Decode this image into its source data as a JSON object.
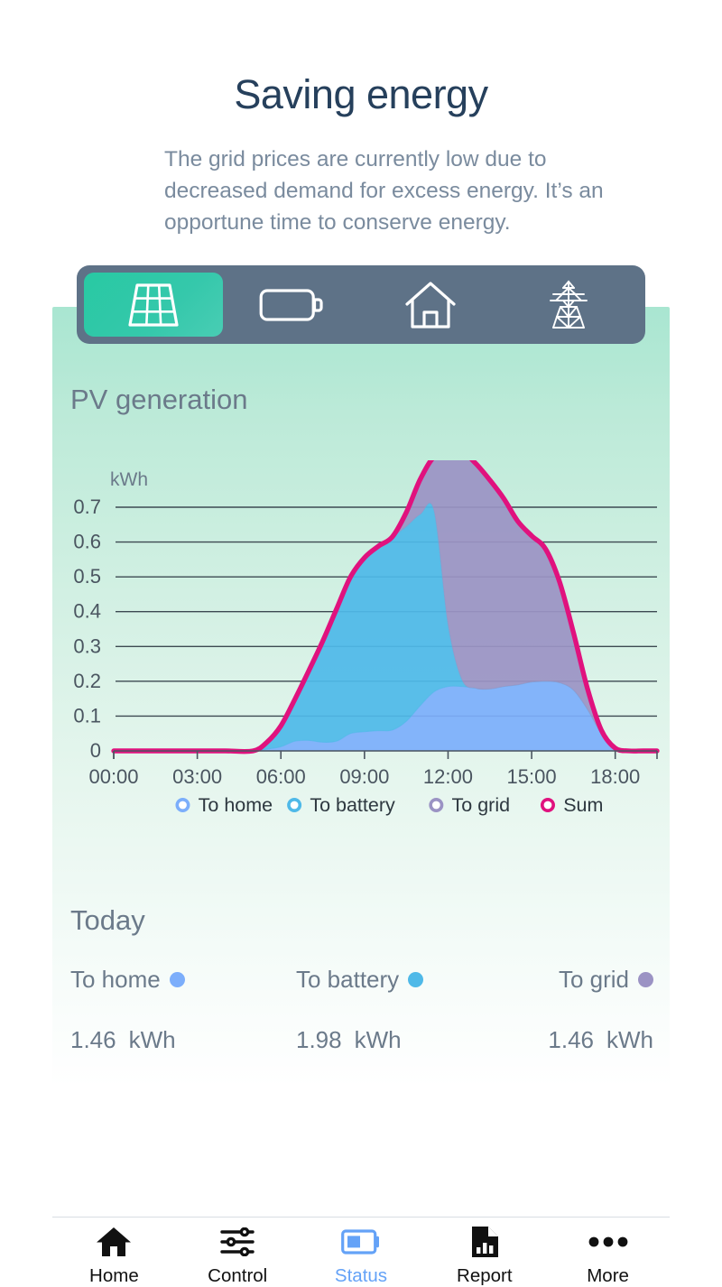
{
  "header": {
    "title": "Saving energy",
    "subtitle": "The grid prices are currently low due to decreased demand for excess energy. It’s an opportune time to conserve energy."
  },
  "segmented_control": {
    "items": [
      {
        "icon": "solar-panel-icon",
        "name": "solar",
        "active": true
      },
      {
        "icon": "battery-icon",
        "name": "battery",
        "active": false
      },
      {
        "icon": "house-icon",
        "name": "home",
        "active": false
      },
      {
        "icon": "power-pylon-icon",
        "name": "grid",
        "active": false
      }
    ]
  },
  "card": {
    "chart_heading": "PV generation",
    "today_heading": "Today"
  },
  "today": {
    "items": [
      {
        "label": "To home",
        "value": "1.46",
        "unit": "kWh",
        "color": "#7CAEFB"
      },
      {
        "label": "To battery",
        "value": "1.98",
        "unit": "kWh",
        "color": "#4FB9E8"
      },
      {
        "label": "To grid",
        "value": "1.46",
        "unit": "kWh",
        "color": "#9B93C4"
      }
    ]
  },
  "bottom_nav": {
    "items": [
      {
        "label": "Home",
        "icon": "home-icon",
        "active": false
      },
      {
        "label": "Control",
        "icon": "sliders-icon",
        "active": false
      },
      {
        "label": "Status",
        "icon": "battery-status-icon",
        "active": true
      },
      {
        "label": "Report",
        "icon": "report-document-icon",
        "active": false
      },
      {
        "label": "More",
        "icon": "ellipsis-icon",
        "active": false
      }
    ],
    "active_color": "#64A2F7",
    "inactive_color": "#111111"
  },
  "chart_data": {
    "type": "area",
    "title": "PV generation",
    "stacked": true,
    "ylabel": "kWh",
    "xlabel": "",
    "ylim": [
      0,
      0.7
    ],
    "ytick_labels": [
      "0",
      "0.1",
      "0.2",
      "0.3",
      "0.4",
      "0.5",
      "0.6",
      "0.7"
    ],
    "ytick_values": [
      0,
      0.1,
      0.2,
      0.3,
      0.4,
      0.5,
      0.6,
      0.7
    ],
    "xtick_labels": [
      "00:00",
      "03:00",
      "06:00",
      "09:00",
      "12:00",
      "15:00",
      "18:00"
    ],
    "xtick_values": [
      0,
      3,
      6,
      9,
      12,
      15,
      18
    ],
    "xlim": [
      0,
      19.5
    ],
    "grid": true,
    "legend_position": "bottom",
    "x": [
      0,
      1,
      2,
      3,
      4,
      5,
      5.5,
      6,
      6.5,
      7,
      7.5,
      8,
      8.5,
      9,
      9.5,
      10,
      10.5,
      11,
      11.5,
      12,
      12.5,
      13,
      13.5,
      14,
      14.5,
      15,
      15.5,
      16,
      16.5,
      17,
      17.5,
      18,
      18.5,
      19,
      19.5
    ],
    "series": [
      {
        "name": "To home",
        "color": "#7CAEFB",
        "values": [
          0,
          0,
          0,
          0,
          0,
          0,
          0.005,
          0.012,
          0.028,
          0.03,
          0.025,
          0.028,
          0.05,
          0.055,
          0.058,
          0.06,
          0.085,
          0.13,
          0.17,
          0.185,
          0.185,
          0.18,
          0.178,
          0.185,
          0.19,
          0.198,
          0.2,
          0.196,
          0.175,
          0.12,
          0.05,
          0.008,
          0,
          0,
          0
        ]
      },
      {
        "name": "To battery",
        "color": "#4FB9E8",
        "values": [
          0,
          0,
          0,
          0,
          0,
          0,
          0.02,
          0.06,
          0.12,
          0.2,
          0.29,
          0.38,
          0.45,
          0.5,
          0.53,
          0.555,
          0.56,
          0.55,
          0.52,
          0.18,
          0.02,
          0,
          0,
          0,
          0,
          0,
          0,
          0,
          0,
          0,
          0,
          0,
          0,
          0,
          0
        ]
      },
      {
        "name": "To grid",
        "color": "#9B93C4",
        "values": [
          0,
          0,
          0,
          0,
          0,
          0,
          0,
          0,
          0,
          0,
          0,
          0,
          0,
          0,
          0,
          0,
          0.04,
          0.1,
          0.155,
          0.49,
          0.655,
          0.645,
          0.6,
          0.54,
          0.47,
          0.42,
          0.38,
          0.29,
          0.165,
          0.06,
          0.01,
          0,
          0,
          0,
          0
        ]
      },
      {
        "name": "Sum",
        "color": "#E0127E",
        "type": "line",
        "values": [
          0,
          0,
          0,
          0,
          0,
          0,
          0.025,
          0.072,
          0.148,
          0.23,
          0.315,
          0.408,
          0.5,
          0.555,
          0.588,
          0.615,
          0.685,
          0.78,
          0.845,
          0.855,
          0.86,
          0.825,
          0.778,
          0.725,
          0.66,
          0.618,
          0.58,
          0.486,
          0.34,
          0.18,
          0.06,
          0.008,
          0,
          0,
          0
        ]
      }
    ],
    "legend": [
      {
        "label": "To home",
        "color": "#7CAEFB"
      },
      {
        "label": "To battery",
        "color": "#4FB9E8"
      },
      {
        "label": "To grid",
        "color": "#9B93C4"
      },
      {
        "label": "Sum",
        "color": "#E0127E"
      }
    ]
  }
}
